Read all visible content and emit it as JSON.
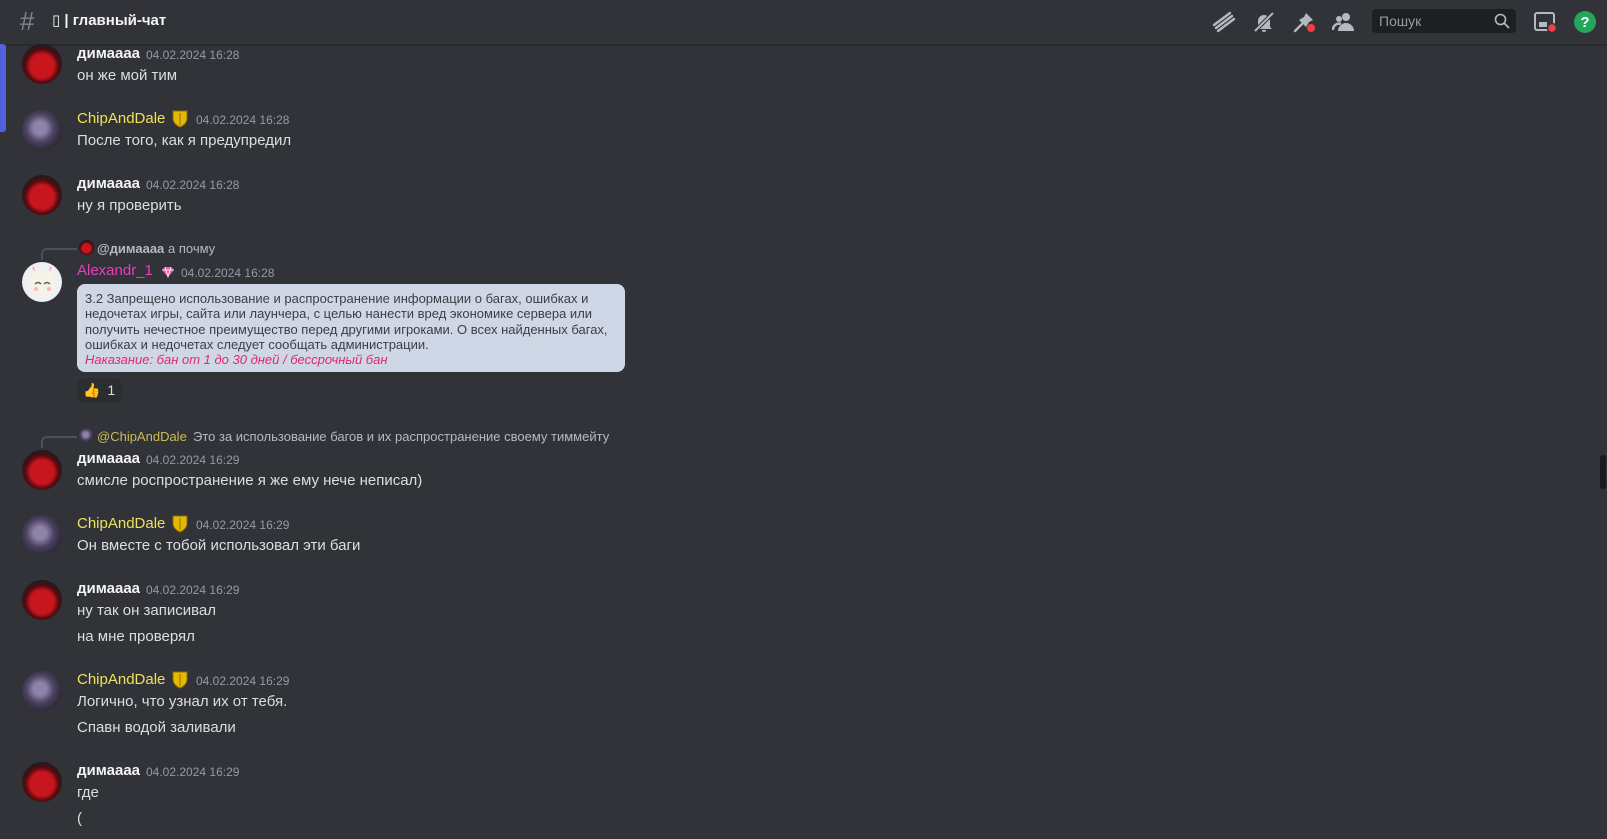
{
  "header": {
    "channel_name": "▯ | главный-чат",
    "search_placeholder": "Пошук"
  },
  "messages": [
    {
      "author": "димаааа",
      "timestamp": "04.02.2024 16:28",
      "lines": [
        "он же мой тим"
      ]
    },
    {
      "author": "ChipAndDale",
      "timestamp": "04.02.2024 16:28",
      "lines": [
        "После того, как я предупредил"
      ]
    },
    {
      "author": "димаааа",
      "timestamp": "04.02.2024 16:28",
      "lines": [
        "ну я проверить"
      ]
    },
    {
      "reply": {
        "name": "@димаааа",
        "text": "а почму"
      },
      "author": "Alexandr_1",
      "timestamp": "04.02.2024 16:28",
      "quote": {
        "lines": [
          "3.2 Запрещено использование и распространение информации о багах, ошибках и",
          "недочетах игры, сайта или лаунчера, с целью нанести вред экономике сервера или",
          "получить нечестное преимущество перед другими игроками. О всех найденных багах,",
          "ошибках и недочетах следует сообщать администрации."
        ],
        "penalty": "Наказание: бан от 1 до 30 дней / бессрочный бан"
      },
      "reaction": {
        "emoji": "👍",
        "count": "1"
      }
    },
    {
      "reply": {
        "name": "@ChipAndDale",
        "text": "Это за использование багов и их распространение своему тиммейту"
      },
      "author": "димаааа",
      "timestamp": "04.02.2024 16:29",
      "lines": [
        "смисле роспространение я же ему нече неписал)"
      ]
    },
    {
      "author": "ChipAndDale",
      "timestamp": "04.02.2024 16:29",
      "lines": [
        "Он вместе с тобой использовал эти баги"
      ]
    },
    {
      "author": "димаааа",
      "timestamp": "04.02.2024 16:29",
      "lines": [
        "ну так он записивал",
        "на мне проверял"
      ]
    },
    {
      "author": "ChipAndDale",
      "timestamp": "04.02.2024 16:29",
      "lines": [
        "Логично, что узнал их от тебя.",
        "Спавн водой заливали"
      ]
    },
    {
      "author": "димаааа",
      "timestamp": "04.02.2024 16:29",
      "lines": [
        "где",
        "("
      ]
    }
  ],
  "colors": {
    "background": "#313338",
    "chip_name": "#f0e15a",
    "alex_name": "#ec3bc1",
    "penalty_text": "#e0296f",
    "quote_bg": "#cfd7e6"
  },
  "icons": [
    "threads-icon",
    "mute-bell-icon",
    "pin-icon",
    "members-icon",
    "search-icon",
    "inbox-icon",
    "help-icon"
  ]
}
